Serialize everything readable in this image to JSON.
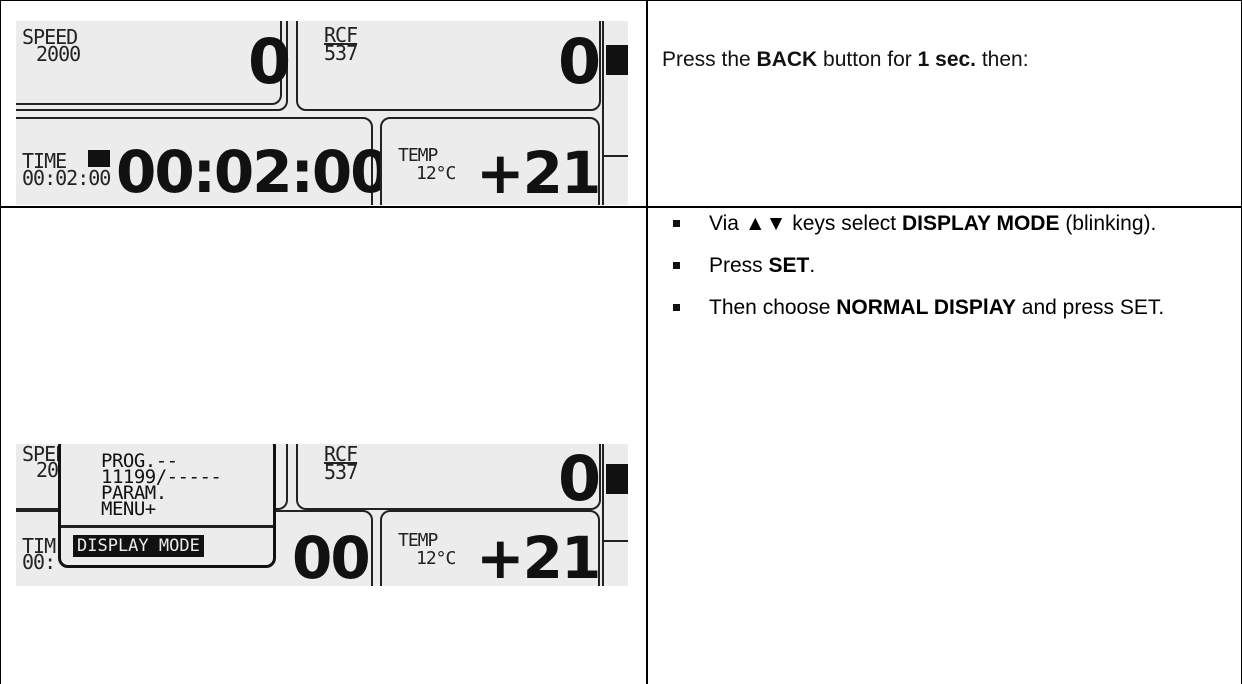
{
  "lcd_main": {
    "speed_label": "SPEED",
    "speed_set": "2000",
    "speed_value": "0",
    "rcf_label": "RCF",
    "rcf_set": "537",
    "rcf_value": "0",
    "time_label": "TIME",
    "time_set": "00:02:00",
    "time_value": "00:02:00",
    "temp_label": "TEMP",
    "temp_set": "12°C",
    "temp_value": "+21"
  },
  "lcd_menu": {
    "speed_label": "SPEED",
    "speed_partial": "20",
    "rcf_label": "RCF",
    "rcf_set": "537",
    "rcf_value": "0",
    "time_label_partial": "TIM",
    "time_set_partial": "00:",
    "time_value_partial": "00",
    "temp_label": "TEMP",
    "temp_set": "12°C",
    "temp_value": "+21",
    "menu_items": [
      "PROG.--",
      "11199/-----",
      "PARAM.",
      "MENU+"
    ],
    "menu_selected": "DISPLAY MODE"
  },
  "instructions": {
    "step_intro": {
      "prefix": "Press the ",
      "back": "BACK",
      "middle": " button for ",
      "duration": "1 sec.",
      "suffix": " then:"
    },
    "bullets": [
      {
        "pre": "Via ",
        "keys": "▲▼",
        "mid": " keys select ",
        "bold": "DISPLAY MODE",
        "post": " (blinking)."
      },
      {
        "pre": "Press ",
        "bold": "SET",
        "post": "."
      },
      {
        "pre": "Then choose ",
        "bold": "NORMAL DISPlAY",
        "post": " and press SET."
      }
    ]
  }
}
